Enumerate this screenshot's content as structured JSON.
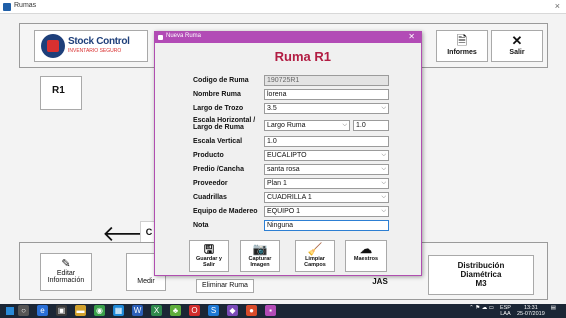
{
  "window": {
    "title": "Rumas",
    "close_icon": "×"
  },
  "header": {
    "logo_name": "Stock Control",
    "logo_sub": "INVENTARIO SEGURO",
    "informes_label": "Informes",
    "salir_label": "Salir"
  },
  "main": {
    "ruma_tile": "R1",
    "c_tile": "C"
  },
  "bottom": {
    "editar_label": "Editar\nInformación",
    "medir_label": "Medir",
    "eliminar_label": "Eliminar Ruma",
    "jas_label": "JAS",
    "distrib_label": "Distribución\nDiamétrica\nM3"
  },
  "dialog": {
    "title": "Nueva Ruma",
    "heading": "Ruma R1",
    "fields": [
      {
        "label": "Codigo de Ruma",
        "value": "190725R1"
      },
      {
        "label": "Nombre Ruma",
        "value": "lorena"
      },
      {
        "label": "Largo de Trozo",
        "value": "3.5"
      },
      {
        "label": "Escala Horizontal / Largo de Ruma",
        "value": "Largo Ruma",
        "value2": "1.0"
      },
      {
        "label": "Escala Vertical",
        "value": "1.0"
      },
      {
        "label": "Producto",
        "value": "EUCALIPTO"
      },
      {
        "label": "Predio /Cancha",
        "value": "santa rosa"
      },
      {
        "label": "Proveedor",
        "value": "Plan 1"
      },
      {
        "label": "Cuadrillas",
        "value": "CUADRILLA 1"
      },
      {
        "label": "Equipo de Madereo",
        "value": "EQUIPO 1"
      },
      {
        "label": "Nota",
        "value": "Ninguna"
      }
    ],
    "buttons": {
      "guardar": "Guardar y Salir",
      "capturar": "Capturar Imagen",
      "limpiar": "Limpiar Campos",
      "maestros": "Maestros"
    }
  },
  "taskbar": {
    "lang_top": "ESP",
    "lang_bottom": "LAA",
    "time": "13:31",
    "date": "25-07/2019"
  },
  "colors": {
    "dialog_title_bg": "#b24bb6",
    "heading": "#b21d43",
    "taskbar": "#1b2635"
  }
}
